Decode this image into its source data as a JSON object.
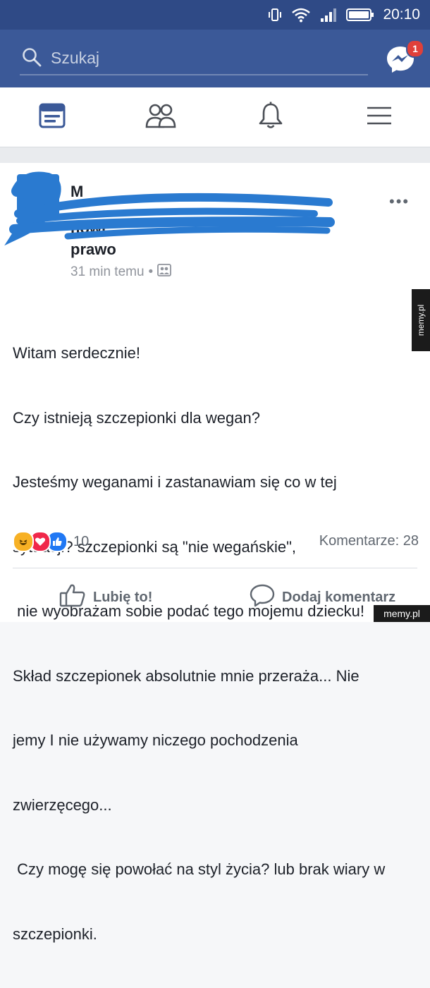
{
  "status_bar": {
    "time": "20:10"
  },
  "header": {
    "search_placeholder": "Szukaj",
    "messenger_badge": "1",
    "colors": {
      "bar": "#3b5998",
      "badge": "#e0403a"
    }
  },
  "nav": {
    "items": [
      "news-feed-icon",
      "friends-icon",
      "notifications-icon",
      "menu-icon"
    ],
    "active": "news-feed-icon",
    "active_color": "#3b5998"
  },
  "post": {
    "author": "M",
    "title_lines": [
      "nowi",
      "prawo"
    ],
    "meta": {
      "time": "31 min temu",
      "separator": "•"
    },
    "body": [
      "Witam serdecznie!",
      "Czy istnieją szczepionki dla wegan?",
      "Jesteśmy weganami i zastanawiam się co w tej",
      "sytuacji? szczepionki są \"nie wegańskie\",",
      " nie wyobrażam sobie podać tego mojemu dziecku!",
      "Skład szczepionek absolutnie mnie przeraża... Nie",
      "jemy I nie używamy niczego pochodzenia",
      "zwierzęcego...",
      " Czy mogę się powołać na styl życia? lub brak wiary w",
      "szczepionki."
    ],
    "reactions": {
      "types": [
        "haha",
        "love",
        "like"
      ],
      "count": "10"
    },
    "comments_label": "Komentarze: 28",
    "actions": {
      "like": "Lubię to!",
      "comment": "Dodaj komentarz"
    }
  },
  "watermarks": {
    "side": "memy.pl",
    "corner": "memy.pl"
  }
}
